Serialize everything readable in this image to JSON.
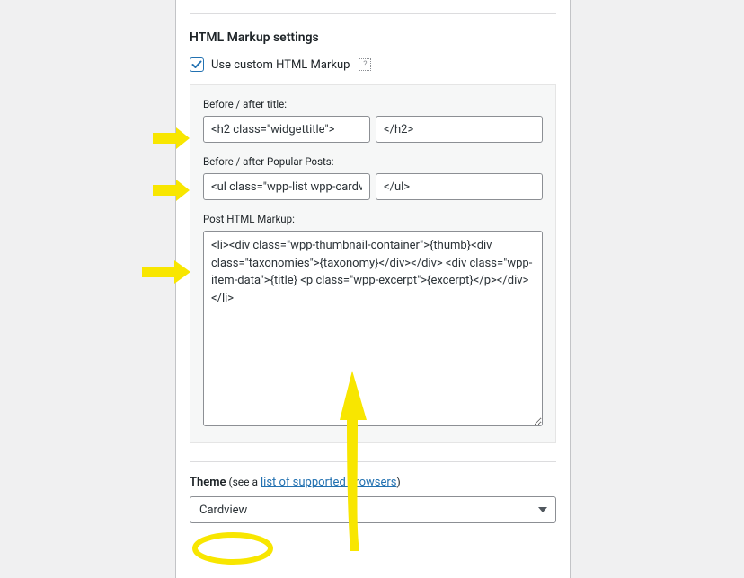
{
  "section": {
    "title": "HTML Markup settings",
    "checkbox_label": "Use custom HTML Markup"
  },
  "fields": {
    "title_label": "Before / after title:",
    "title_before": "<h2 class=\"widgettitle\">",
    "title_after": "</h2>",
    "popular_label": "Before / after Popular Posts:",
    "popular_before": "<ul class=\"wpp-list wpp-cardview\">",
    "popular_after": "</ul>",
    "post_label": "Post HTML Markup:",
    "post_markup": "<li><div class=\"wpp-thumbnail-container\">{thumb}<div class=\"taxonomies\">{taxonomy}</div></div> <div class=\"wpp-item-data\">{title} <p class=\"wpp-excerpt\">{excerpt}</p></div></li>"
  },
  "theme": {
    "label": "Theme",
    "note_prefix": " (see a ",
    "link_text": "list of supported browsers",
    "note_suffix": ")",
    "selected": "Cardview"
  },
  "annotation_color": "#f8e600"
}
